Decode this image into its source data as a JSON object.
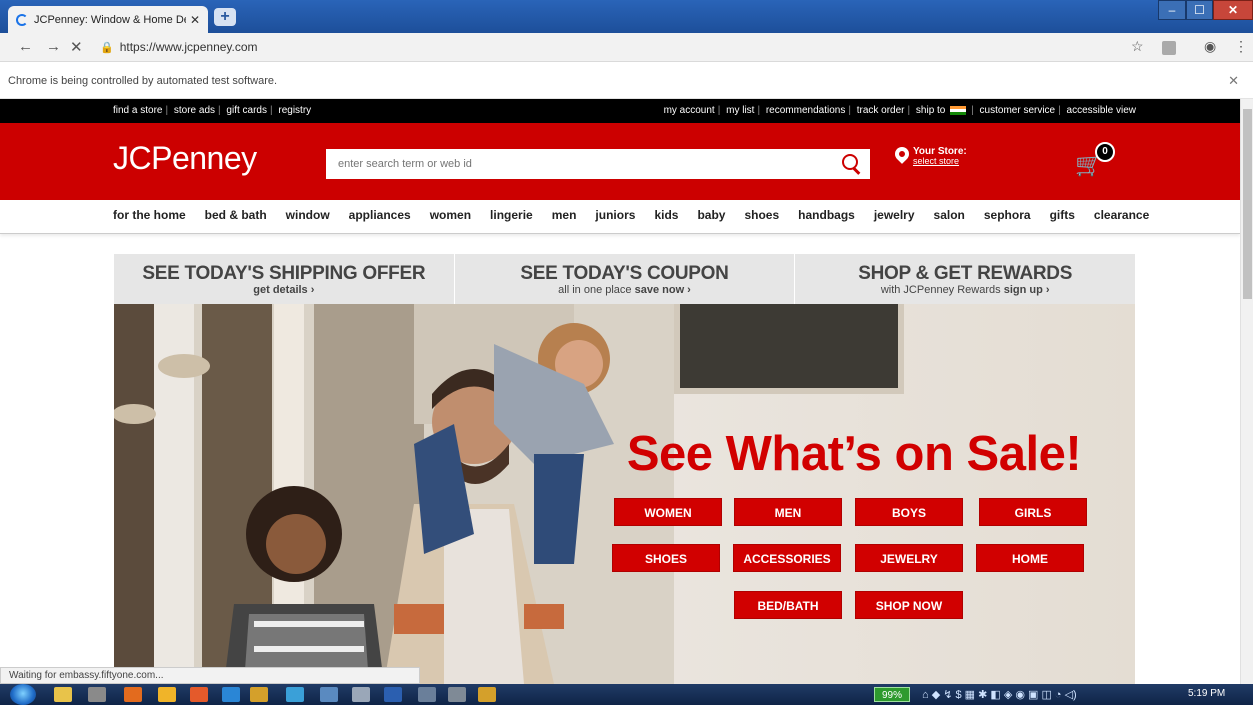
{
  "browser": {
    "tab_title": "JCPenney: Window & Home Dec",
    "url": "https://www.jcpenney.com",
    "infobar_text": "Chrome is being controlled by automated test software.",
    "status_text": "Waiting for embassy.fiftyone.com..."
  },
  "topstrip": {
    "left_links": [
      "find a store",
      "store ads",
      "gift cards",
      "registry"
    ],
    "right_links": [
      "my account",
      "my list",
      "recommendations",
      "track order",
      "ship to",
      "customer service",
      "accessible view"
    ]
  },
  "header": {
    "logo": "JCPenney",
    "search_placeholder": "enter search term or web id",
    "store_label": "Your Store:",
    "store_link": "select store",
    "cart_count": "0"
  },
  "categories": [
    "for the home",
    "bed & bath",
    "window",
    "appliances",
    "women",
    "lingerie",
    "men",
    "juniors",
    "kids",
    "baby",
    "shoes",
    "handbags",
    "jewelry",
    "salon",
    "sephora",
    "gifts",
    "clearance"
  ],
  "promos": [
    {
      "title": "SEE TODAY'S SHIPPING OFFER",
      "sub_plain": "",
      "sub_bold": "get details ›"
    },
    {
      "title": "SEE TODAY'S COUPON",
      "sub_plain": "all in one place ",
      "sub_bold": "save now ›"
    },
    {
      "title": "SHOP & GET REWARDS",
      "sub_plain": "with JCPenney Rewards ",
      "sub_bold": "sign up ›"
    }
  ],
  "hero": {
    "headline": "See What’s on Sale!",
    "buttons": [
      "WOMEN",
      "MEN",
      "BOYS",
      "GIRLS",
      "SHOES",
      "ACCESSORIES",
      "JEWELRY",
      "HOME",
      "BED/BATH",
      "SHOP NOW"
    ]
  },
  "taskbar": {
    "battery": "99%",
    "clock": "5:19 PM"
  },
  "colors": {
    "brand_red": "#cc0000",
    "hero_red": "#d10000"
  }
}
